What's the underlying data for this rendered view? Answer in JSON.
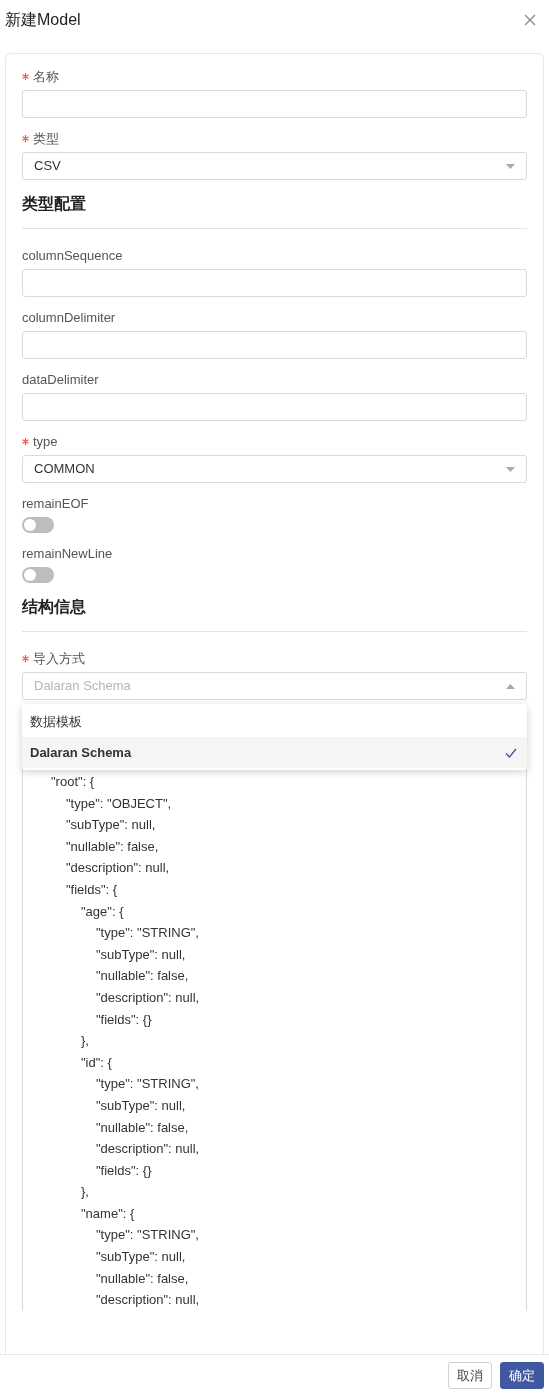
{
  "dialog": {
    "title": "新建Model"
  },
  "form_items": [
    {
      "kind": "input",
      "label": "名称",
      "required": true
    },
    {
      "kind": "select",
      "label": "类型",
      "required": true,
      "value": "CSV"
    },
    {
      "kind": "heading",
      "label": "类型配置"
    },
    {
      "kind": "input",
      "label": "columnSequence",
      "required": false
    },
    {
      "kind": "input",
      "label": "columnDelimiter",
      "required": false
    },
    {
      "kind": "input",
      "label": "dataDelimiter",
      "required": false
    },
    {
      "kind": "select",
      "label": "type",
      "required": true,
      "value": "COMMON"
    },
    {
      "kind": "toggle",
      "label": "remainEOF",
      "required": false,
      "on": false
    },
    {
      "kind": "toggle",
      "label": "remainNewLine",
      "required": false,
      "on": false
    },
    {
      "kind": "heading",
      "label": "结构信息"
    },
    {
      "kind": "select",
      "label": "导入方式",
      "required": true,
      "value": "Dalaran Schema",
      "open": true,
      "options": [
        {
          "label": "数据模板",
          "selected": false
        },
        {
          "label": "Dalaran Schema",
          "selected": true
        }
      ]
    }
  ],
  "code_editor": {
    "lines": [
      {
        "text": "\"root\": {",
        "children": [
          {
            "text": "\"type\": \"OBJECT\","
          },
          {
            "text": "\"subType\": null,"
          },
          {
            "text": "\"nullable\": false,"
          },
          {
            "text": "\"description\": null,"
          },
          {
            "text": "\"fields\": {",
            "children": [
              {
                "text": "\"age\": {",
                "children": [
                  {
                    "text": "\"type\": \"STRING\","
                  },
                  {
                    "text": "\"subType\": null,"
                  },
                  {
                    "text": "\"nullable\": false,"
                  },
                  {
                    "text": "\"description\": null,"
                  },
                  {
                    "text": "\"fields\": {}"
                  }
                ]
              },
              {
                "text": "},"
              },
              {
                "text": "\"id\": {",
                "children": [
                  {
                    "text": "\"type\": \"STRING\","
                  },
                  {
                    "text": "\"subType\": null,"
                  },
                  {
                    "text": "\"nullable\": false,"
                  },
                  {
                    "text": "\"description\": null,"
                  },
                  {
                    "text": "\"fields\": {}"
                  }
                ]
              },
              {
                "text": "},"
              },
              {
                "text": "\"name\": {",
                "children": [
                  {
                    "text": "\"type\": \"STRING\","
                  },
                  {
                    "text": "\"subType\": null,"
                  },
                  {
                    "text": "\"nullable\": false,"
                  },
                  {
                    "text": "\"description\": null,"
                  }
                ]
              }
            ]
          }
        ]
      }
    ]
  },
  "footer": {
    "buttons": [
      {
        "label": "取消",
        "kind": "default"
      },
      {
        "label": "确定",
        "kind": "primary"
      }
    ]
  }
}
